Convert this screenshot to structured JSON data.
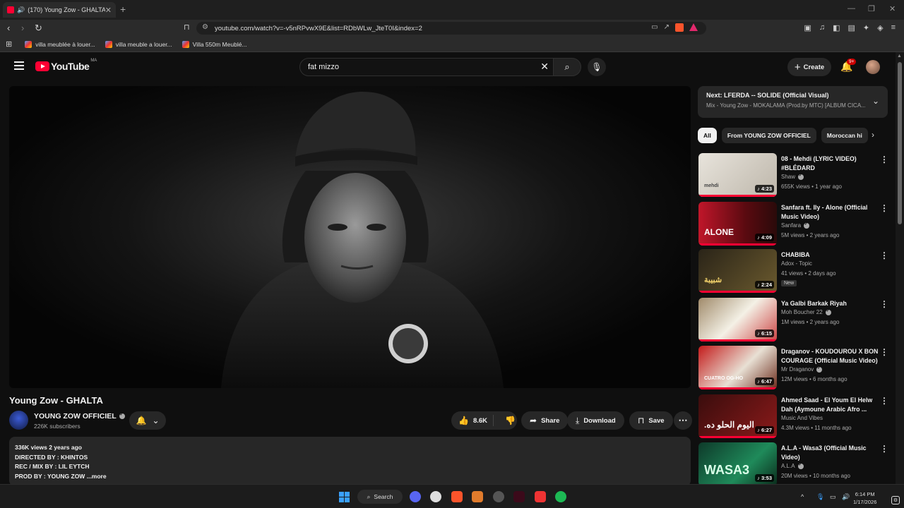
{
  "browser": {
    "tab_title": "(170) Young Zow - GHALTA",
    "tab_close": "✕",
    "new_tab": "+",
    "window_controls": [
      "—",
      "❐",
      "✕"
    ],
    "url": "youtube.com/watch?v=-v5nRPvwX9E&list=RDbWLw_JteT0I&index=2",
    "bookmarks": [
      "villa meublée à louer...",
      "villa meuble a louer...",
      "Villa 550m Meublé..."
    ]
  },
  "header": {
    "logo_text": "YouTube",
    "country_code": "MA",
    "search_value": "fat mizzo",
    "create_label": "Create",
    "notif_count": "9+"
  },
  "video": {
    "title": "Young Zow - GHALTA",
    "channel": "YOUNG ZOW OFFICIEL",
    "subscribers": "226K subscribers",
    "likes": "8.6K",
    "share_label": "Share",
    "download_label": "Download",
    "save_label": "Save",
    "views_line": "336K views  2 years ago",
    "desc_lines": [
      "DIRECTED BY  : KHINTOS",
      "REC / MIX BY : LIL EYTCH",
      "PROD BY : YOUNG ZOW"
    ],
    "more_label": "...more"
  },
  "sidebar": {
    "next_prefix": "Next:",
    "next_title": "LFERDA -- SOLIDE (Official Visual)",
    "next_sub": "Mix - Young Zow - MOKALAMA (Prod.by MTC) [ALBUM CICA...",
    "chips": [
      "All",
      "From YOUNG ZOW OFFICIEL",
      "Moroccan hi"
    ],
    "recs": [
      {
        "title": "08 - Mehdi (LYRIC VIDEO) #BLÉDARD",
        "channel": "Shaw",
        "verified": true,
        "meta": "655K views • 1 year ago",
        "duration": "4:23",
        "badge": ""
      },
      {
        "title": "Sanfara ft. Ily - Alone (Official Music Video)",
        "channel": "Sanfara",
        "verified": true,
        "meta": "5M views • 2 years ago",
        "duration": "4:09",
        "badge": ""
      },
      {
        "title": "CHABIBA",
        "channel": "Adox - Topic",
        "verified": false,
        "meta": "41 views • 2 days ago",
        "duration": "2:24",
        "badge": "New"
      },
      {
        "title": "Ya Galbi Barkak Riyah",
        "channel": "Moh Boucher 22",
        "verified": true,
        "meta": "1M views • 2 years ago",
        "duration": "6:15",
        "badge": ""
      },
      {
        "title": "Draganov - KOUDOUROU X BON COURAGE (Official Music Video)",
        "channel": "Mr Draganov",
        "verified": true,
        "meta": "12M views • 6 months ago",
        "duration": "6:47",
        "badge": ""
      },
      {
        "title": "Ahmed Saad - El Youm El Helw Dah (Aymoune Arabic Afro ...",
        "channel": "Music And Vibes",
        "verified": false,
        "meta": "4.3M views • 11 months ago",
        "duration": "6:27",
        "badge": ""
      },
      {
        "title": "A.L.A - Wasa3 (Official Music Video)",
        "channel": "A.L.A",
        "verified": true,
        "meta": "20M views • 10 months ago",
        "duration": "3:53",
        "badge": ""
      }
    ]
  },
  "thumb_text": {
    "mehdi": "mehdi",
    "alone": "ALONE",
    "chabiba": "شبيبة",
    "cuatro": "CUATRO OG-HO",
    "arabic": ".اليوم الحلو ده",
    "wasa3": "WASA3"
  },
  "taskbar": {
    "search_label": "Search",
    "time": "6:14 PM",
    "date": "1/17/2026"
  },
  "colors": {
    "accent": "#ff0033",
    "bg": "#0f0f0f",
    "panel": "#272727"
  }
}
